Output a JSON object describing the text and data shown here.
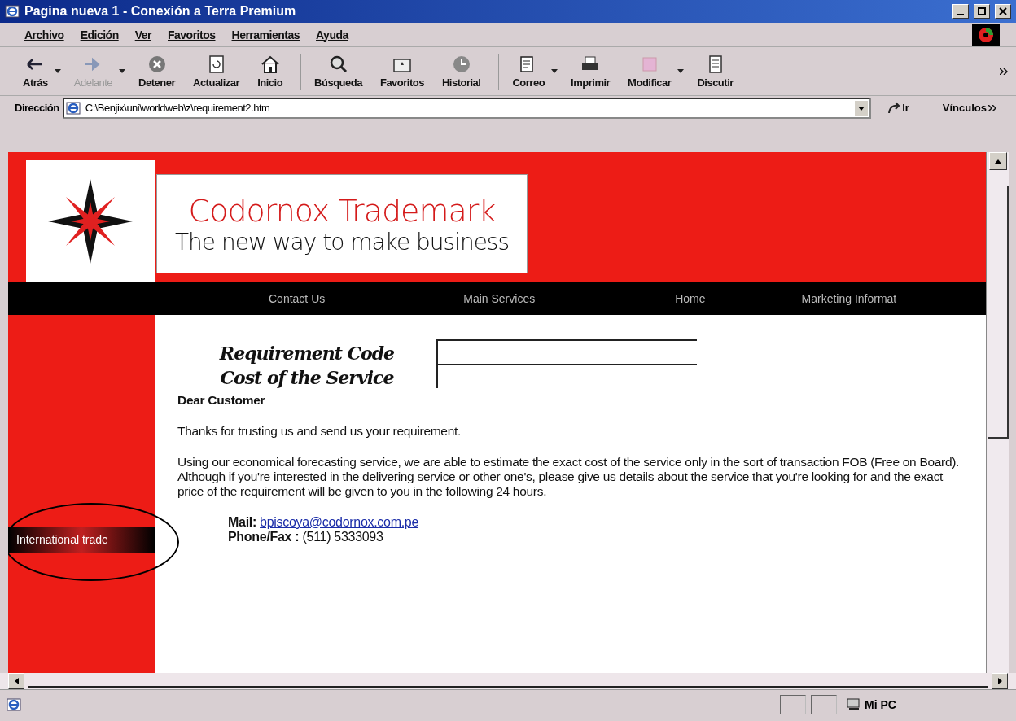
{
  "window": {
    "title": "Pagina nueva 1 - Conexión a Terra Premium"
  },
  "menu": [
    "Archivo",
    "Edición",
    "Ver",
    "Favoritos",
    "Herramientas",
    "Ayuda"
  ],
  "toolbar": [
    {
      "label": "Atrás",
      "disabled": false,
      "dropdown": true
    },
    {
      "label": "Adelante",
      "disabled": true,
      "dropdown": true
    },
    {
      "label": "Detener",
      "disabled": false,
      "dropdown": false
    },
    {
      "label": "Actualizar",
      "disabled": false,
      "dropdown": false
    },
    {
      "label": "Inicio",
      "disabled": false,
      "dropdown": false
    },
    {
      "label": "Búsqueda",
      "disabled": false,
      "dropdown": false
    },
    {
      "label": "Favoritos",
      "disabled": false,
      "dropdown": false
    },
    {
      "label": "Historial",
      "disabled": false,
      "dropdown": false
    },
    {
      "label": "Correo",
      "disabled": false,
      "dropdown": true
    },
    {
      "label": "Imprimir",
      "disabled": false,
      "dropdown": false
    },
    {
      "label": "Modificar",
      "disabled": false,
      "dropdown": true
    },
    {
      "label": "Discutir",
      "disabled": false,
      "dropdown": false
    }
  ],
  "address": {
    "label": "Dirección",
    "value": "C:\\Benjix\\uni\\worldweb\\z\\requirement2.htm",
    "go": "Ir",
    "links": "Vínculos"
  },
  "site": {
    "brand": "Codornox Trademark",
    "slogan": "The new way to make business",
    "nav": [
      "Contact Us",
      "Main Services",
      "Home",
      "Marketing Informat"
    ],
    "side": [
      {
        "label": "International trade",
        "circled": true
      }
    ],
    "fields": [
      {
        "label": "Requirement Code"
      },
      {
        "label": "Cost of the Service"
      }
    ],
    "greeting": "Dear Customer",
    "paragraphs": [
      "Thanks for trusting us and send us your requirement.",
      "Using our  economical forecasting service, we are able to estimate the  exact cost of the service only in the sort of transaction FOB (Free on Board). Although if you're interested in the delivering service or other one's, please give us details about the service that you're looking for and the exact price of the requirement will be given to you in the following 24 hours."
    ],
    "mail_label": "Mail:",
    "mail": "bpiscoya@codornox.com.pe",
    "phone_label": "Phone/Fax :",
    "phone": "(511) 5333093"
  },
  "status": {
    "zone": "Mi PC"
  }
}
